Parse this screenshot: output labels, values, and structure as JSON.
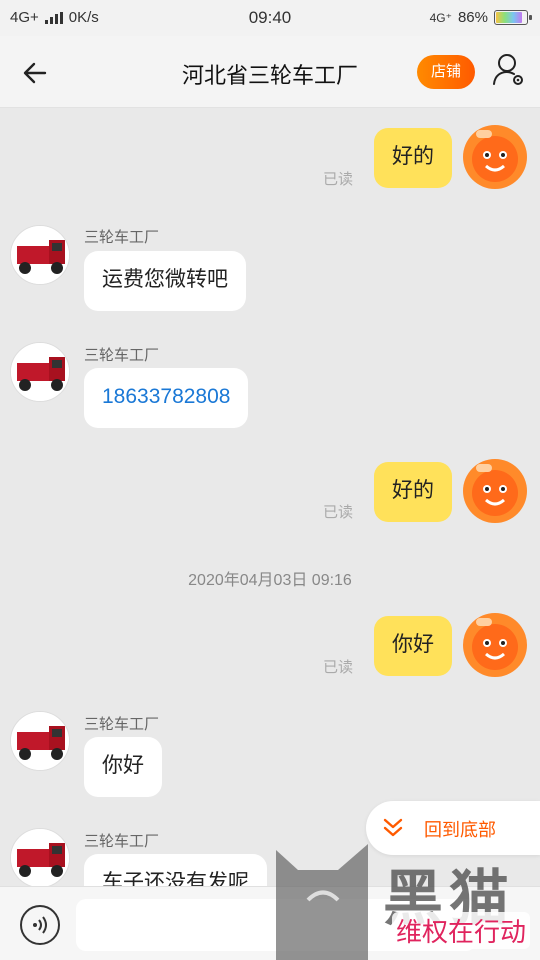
{
  "status_bar": {
    "network": "4G+",
    "speed": "0K/s",
    "time": "09:40",
    "net_right": "4G⁺",
    "battery": "86%"
  },
  "header": {
    "title": "河北省三轮车工厂",
    "shop_label": "店铺",
    "icons": [
      "back-arrow-icon",
      "profile-settings-icon"
    ]
  },
  "colors": {
    "accent": "#ff5a00",
    "my_bubble": "#ffe15a",
    "link": "#1a78d6"
  },
  "messages": [
    {
      "side": "me",
      "text": "好的",
      "status": "已读"
    },
    {
      "side": "other",
      "sender": "三轮车工厂",
      "text": "运费您微转吧"
    },
    {
      "side": "other",
      "sender": "三轮车工厂",
      "text": "18633782808",
      "is_link": true
    },
    {
      "side": "me",
      "text": "好的",
      "status": "已读"
    },
    {
      "side": "system",
      "text": "2020年04月03日 09:16"
    },
    {
      "side": "me",
      "text": "你好",
      "status": "已读"
    },
    {
      "side": "other",
      "sender": "三轮车工厂",
      "text": "你好"
    },
    {
      "side": "other",
      "sender": "三轮车工厂",
      "text": "车子还没有发呢"
    }
  ],
  "back_to_bottom": {
    "label": "回到底部",
    "icon": "double-chevron-down-icon"
  },
  "input_bar": {
    "placeholder": "",
    "icon": "voice-icon"
  },
  "watermark": {
    "text": "黑猫",
    "sub": "维权在行动"
  }
}
